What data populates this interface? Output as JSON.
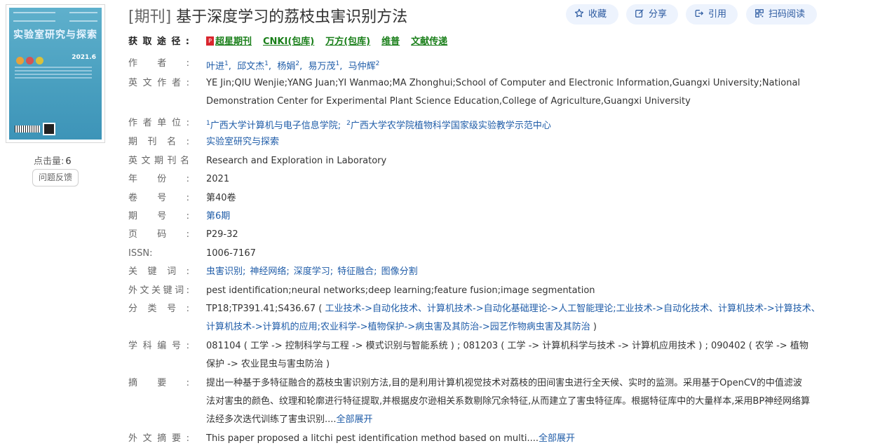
{
  "cover": {
    "title": "实验室研究与探索",
    "year_issue": "2021.6"
  },
  "stats": {
    "clicks_label": "点击量:",
    "clicks_value": "6"
  },
  "feedback_label": "问题反馈",
  "article": {
    "type_tag": "[期刊]",
    "title": "基于深度学习的荔枝虫害识别方法"
  },
  "actions": {
    "favorite": "收藏",
    "share": "分享",
    "cite": "引用",
    "scan": "扫码阅读"
  },
  "labels": {
    "access": "获取途径:",
    "authors": "作者:",
    "en_authors": "英文作者:",
    "affiliations": "作者单位:",
    "journal": "期刊名:",
    "en_journal": "英文期刊名",
    "year": "年份:",
    "volume": "卷号:",
    "issue": "期号:",
    "pages": "页码:",
    "issn": "ISSN:",
    "keywords": "关键词:",
    "en_keywords": "外文关键词:",
    "classification": "分类号:",
    "subject": "学科编号:",
    "abstract": "摘要:",
    "en_abstract": "外文摘要:"
  },
  "access_sources": [
    "超星期刊",
    "CNKI(包库)",
    "万方(包库)",
    "维普",
    "文献传递"
  ],
  "authors": [
    {
      "name": "叶进",
      "sup": "1"
    },
    {
      "name": "邱文杰",
      "sup": "1"
    },
    {
      "name": "杨娟",
      "sup": "2"
    },
    {
      "name": "易万茂",
      "sup": "1"
    },
    {
      "name": "马仲辉",
      "sup": "2"
    }
  ],
  "en_authors_line1": "YE Jin;QIU Wenjie;YANG Juan;YI Wanmao;MA Zhonghui;School of Computer and Electronic Information,Guangxi University;National",
  "en_authors_line2": "Demonstration Center for Experimental Plant Science Education,College of Agriculture,Guangxi University",
  "affiliations": [
    {
      "sup": "1",
      "name": "广西大学计算机与电子信息学院;"
    },
    {
      "sup": "2",
      "name": "广西大学农学院植物科学国家级实验教学示范中心"
    }
  ],
  "journal": "实验室研究与探索",
  "en_journal": "Research and Exploration in Laboratory",
  "year": "2021",
  "volume": "第40卷",
  "issue": "第6期",
  "pages": "P29-32",
  "issn": "1006-7167",
  "keywords": [
    "虫害识别;",
    "神经网络;",
    "深度学习;",
    "特征融合;",
    "图像分割"
  ],
  "en_keywords": "pest identification;neural networks;deep learning;feature fusion;image segmentation",
  "classification": {
    "codes": "TP18;TP391.41;S436.67",
    "line1_paths": "工业技术->自动化技术、计算机技术->自动化基础理论->人工智能理论;工业技术->自动化技术、计算机技术->计算技术、",
    "line2_paths": "计算机技术->计算机的应用;农业科学->植物保护->病虫害及其防治->园艺作物病虫害及其防治"
  },
  "subject": {
    "line1": "081104 ( 工学 -> 控制科学与工程 -> 模式识别与智能系统 ) ;  081203 ( 工学 -> 计算机科学与技术 -> 计算机应用技术 ) ;  090402 ( 农学 -> 植物",
    "line2": "保护 -> 农业昆虫与害虫防治 )"
  },
  "abstract": {
    "line1": "提出一种基于多特征融合的荔枝虫害识别方法,目的是利用计算机视觉技术对荔枝的田间害虫进行全天候、实时的监测。采用基于OpenCV的中值滤波",
    "line2": "法对害虫的颜色、纹理和轮廓进行特征提取,并根据皮尔逊相关系数剔除冗余特征,从而建立了害虫特征库。根据特征库中的大量样本,采用BP神经网络算",
    "line3": "法经多次迭代训练了害虫识别....",
    "expand": "全部展开"
  },
  "en_abstract": {
    "text": "This paper proposed a litchi pest identification method based on multi....",
    "expand": "全部展开"
  },
  "colors": {
    "link": "#1f5ca8",
    "source_green": "#1a7f1a",
    "action_bg": "#edf3fd"
  }
}
